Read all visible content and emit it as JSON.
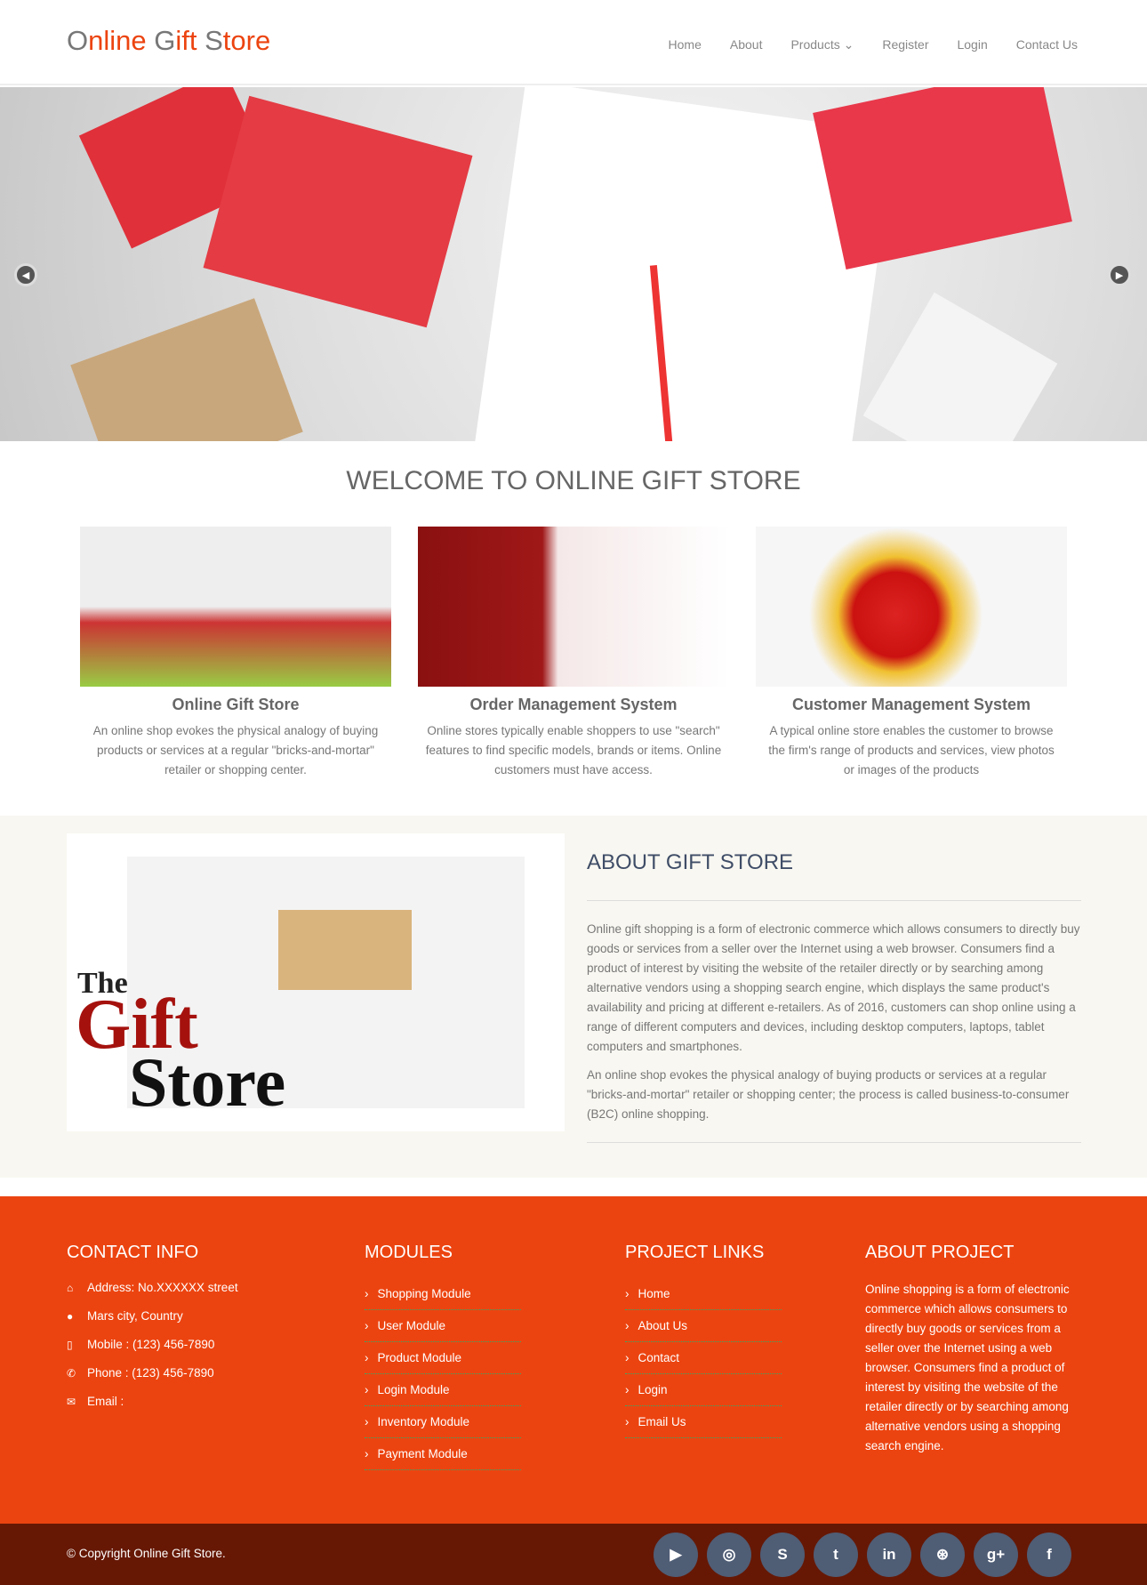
{
  "header": {
    "logo_part1": "O",
    "logo_part2": "nline ",
    "logo_part3": "G",
    "logo_part4": "ift ",
    "logo_part5": "S",
    "logo_part6": "tore",
    "nav": [
      {
        "label": "Home"
      },
      {
        "label": "About"
      },
      {
        "label": "Products ⌄"
      },
      {
        "label": "Register"
      },
      {
        "label": "Login"
      },
      {
        "label": "Contact Us"
      }
    ]
  },
  "hero": {
    "prev_icon": "chevron-left",
    "next_icon": "chevron-right"
  },
  "welcome": {
    "title": "WELCOME TO ONLINE GIFT STORE"
  },
  "cards": [
    {
      "title": "Online Gift Store",
      "text": "An online shop evokes the physical analogy of buying products or services at a regular \"bricks-and-mortar\" retailer or shopping center."
    },
    {
      "title": "Order Management System",
      "text": "Online stores typically enable shoppers to use \"search\" features to find specific models, brands or items. Online customers must have access."
    },
    {
      "title": "Customer Management System",
      "text": "A typical online store enables the customer to browse the firm's range of products and services, view photos or images of the products"
    }
  ],
  "about": {
    "image_text": [
      "The",
      "Gift",
      "Store"
    ],
    "title": "ABOUT GIFT STORE",
    "p1": "Online gift shopping is a form of electronic commerce which allows consumers to directly buy goods or services from a seller over the Internet using a web browser. Consumers find a product of interest by visiting the website of the retailer directly or by searching among alternative vendors using a shopping search engine, which displays the same product's availability and pricing at different e-retailers. As of 2016, customers can shop online using a range of different computers and devices, including desktop computers, laptops, tablet computers and smartphones.",
    "p2": "An online shop evokes the physical analogy of buying products or services at a regular \"bricks-and-mortar\" retailer or shopping center; the process is called business-to-consumer (B2C) online shopping."
  },
  "footer": {
    "contact": {
      "title": "CONTACT INFO",
      "items": [
        {
          "icon": "home",
          "text": "Address: No.XXXXXX street"
        },
        {
          "icon": "globe",
          "text": "Mars city, Country"
        },
        {
          "icon": "mobile",
          "text": "Mobile : (123) 456-7890"
        },
        {
          "icon": "phone",
          "text": "Phone : (123) 456-7890"
        },
        {
          "icon": "envelope",
          "text": "Email :"
        }
      ]
    },
    "modules": {
      "title": "MODULES",
      "items": [
        "Shopping Module",
        "User Module",
        "Product Module",
        "Login Module",
        "Inventory Module",
        "Payment Module"
      ]
    },
    "links": {
      "title": "PROJECT LINKS",
      "items": [
        "Home",
        "About Us",
        "Contact",
        "Login",
        "Email Us"
      ]
    },
    "about": {
      "title": "ABOUT PROJECT",
      "text": "Online shopping is a form of electronic commerce which allows consumers to directly buy goods or services from a seller over the Internet using a web browser. Consumers find a product of interest by visiting the website of the retailer directly or by searching among alternative vendors using a shopping search engine."
    },
    "copyright": "© Copyright Online Gift Store.",
    "social": [
      {
        "icon": "youtube",
        "glyph": "▶"
      },
      {
        "icon": "github",
        "glyph": "◎"
      },
      {
        "icon": "skype",
        "glyph": "S"
      },
      {
        "icon": "twitter",
        "glyph": "t"
      },
      {
        "icon": "linkedin",
        "glyph": "in"
      },
      {
        "icon": "dribbble",
        "glyph": "⊛"
      },
      {
        "icon": "google-plus",
        "glyph": "g+"
      },
      {
        "icon": "facebook",
        "glyph": "f"
      }
    ]
  },
  "colors": {
    "accent": "#ec4410",
    "footer_dark": "#661805",
    "social_bg": "#4f5d75",
    "about_bg": "#f8f7f1"
  }
}
